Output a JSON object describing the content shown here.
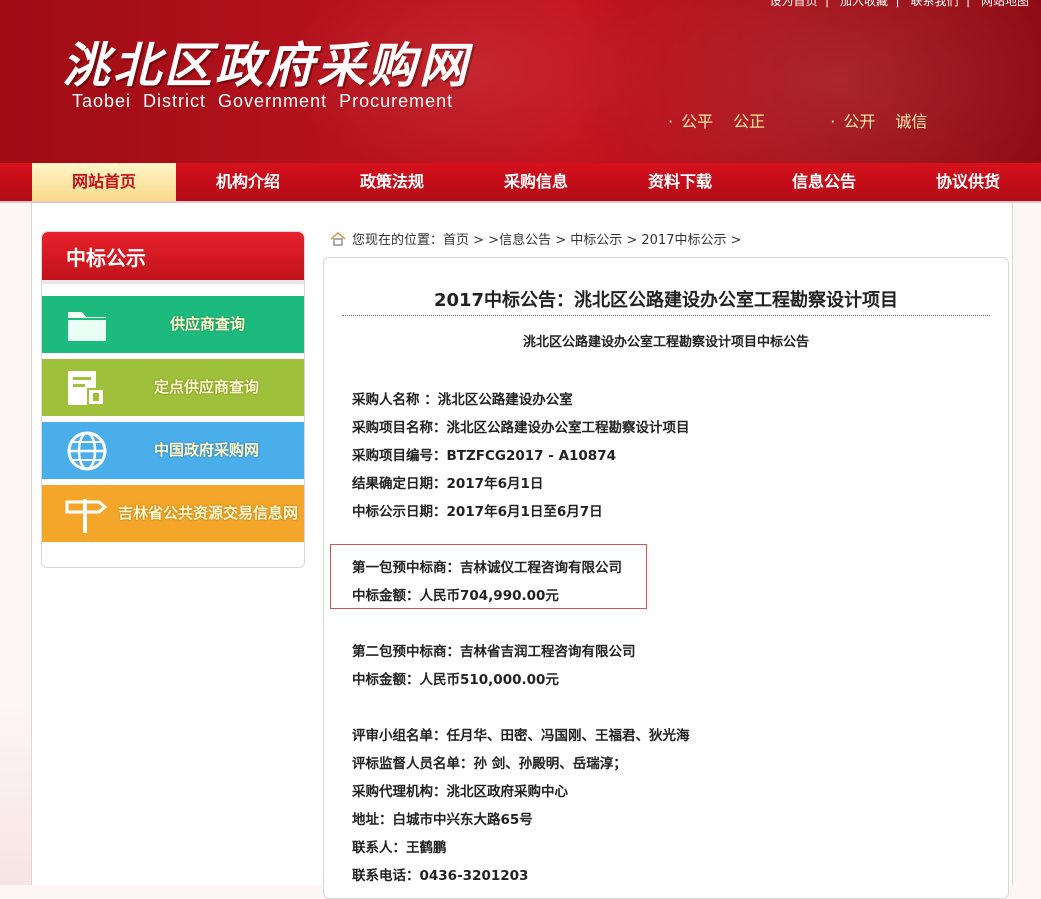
{
  "header": {
    "top_links": [
      "设为首页",
      "加入收藏",
      "联系我们",
      "网站地图"
    ],
    "title": "洮北区政府采购网",
    "subtitle": "Taobei District Government Procurement",
    "slogans": [
      {
        "items": [
          "公平",
          "公正"
        ]
      },
      {
        "items": [
          "公开",
          "诚信"
        ]
      }
    ]
  },
  "nav": {
    "items": [
      "网站首页",
      "机构介绍",
      "政策法规",
      "采购信息",
      "资料下载",
      "信息公告",
      "协议供货"
    ],
    "active_index": 0
  },
  "sidebar": {
    "title": "中标公示",
    "tiles": [
      {
        "label": "供应商查询",
        "icon": "folder-icon",
        "color": "#1dba7e"
      },
      {
        "label": "定点供应商查询",
        "icon": "document-lock-icon",
        "color": "#9ec03a"
      },
      {
        "label": "中国政府采购网",
        "icon": "globe-icon",
        "color": "#4aaeea"
      },
      {
        "label": "吉林省公共资源交易信息网",
        "icon": "signpost-icon",
        "color": "#f4a62a"
      }
    ]
  },
  "breadcrumb": {
    "prefix": "您现在的位置：",
    "path": "首页 > >信息公告 > 中标公示 > 2017中标公示 >"
  },
  "article": {
    "title": "2017中标公告：洮北区公路建设办公室工程勘察设计项目",
    "subtitle": "洮北区公路建设办公室工程勘察设计项目中标公告",
    "lines": [
      "采购人名称 ：洮北区公路建设办公室",
      "采购项目名称：洮北区公路建设办公室工程勘察设计项目",
      "采购项目编号：BTZFCG2017 - A10874",
      "结果确定日期：2017年6月1日",
      "中标公示日期：2017年6月1日至6月7日",
      "第一包预中标商：吉林诚仪工程咨询有限公司",
      "中标金额：人民币704,990.00元",
      "第二包预中标商：吉林省吉润工程咨询有限公司",
      "中标金额：人民币510,000.00元",
      "评审小组名单：任月华、田密、冯国刚、王福君、狄光海",
      "评标监督人员名单：孙  剑、孙殿明、岳瑞淳；",
      "采购代理机构：洮北区政府采购中心",
      "地址：白城市中兴东大路65号",
      "联系人：王鹤鹏",
      "联系电话：0436-3201203"
    ]
  },
  "colors": {
    "brand_red": "#c3141f",
    "highlight_border": "#d9534f"
  }
}
